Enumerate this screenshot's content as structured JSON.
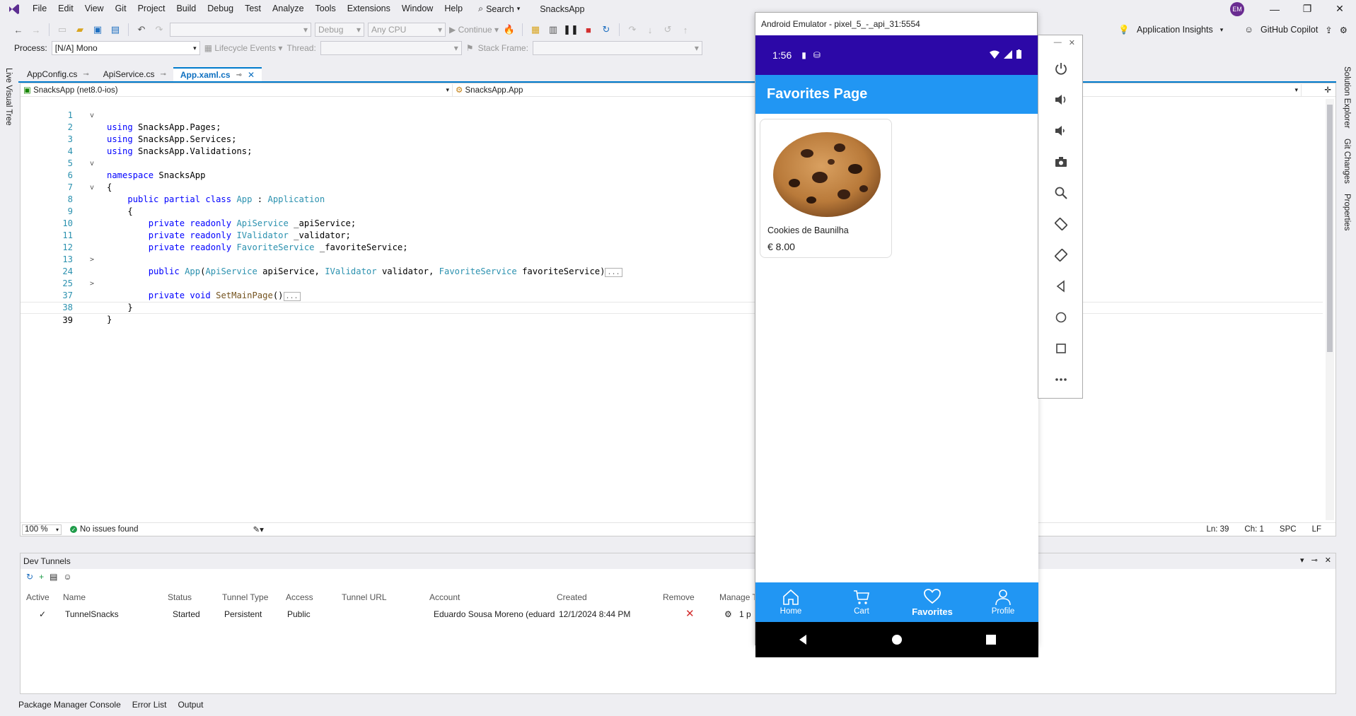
{
  "menubar": {
    "items": [
      "File",
      "Edit",
      "View",
      "Git",
      "Project",
      "Build",
      "Debug",
      "Test",
      "Analyze",
      "Tools",
      "Extensions",
      "Window",
      "Help"
    ],
    "search_label": "Search",
    "solution_name": "SnacksApp",
    "avatar_initials": "EM"
  },
  "toolbar": {
    "config": "Debug",
    "platform": "Any CPU",
    "continue_label": "Continue",
    "app_insights": "Application Insights",
    "copilot": "GitHub Copilot"
  },
  "debug_toolbar": {
    "process_label": "Process:",
    "process_value": "[N/A] Mono",
    "lifecycle": "Lifecycle Events",
    "thread_label": "Thread:",
    "stack_label": "Stack Frame:"
  },
  "side_tabs": {
    "left": "Live Visual Tree",
    "right": [
      "Solution Explorer",
      "Git Changes",
      "Properties"
    ]
  },
  "doc_tabs": [
    {
      "label": "AppConfig.cs"
    },
    {
      "label": "ApiService.cs"
    },
    {
      "label": "App.xaml.cs"
    }
  ],
  "editor": {
    "project_combo": "SnacksApp (net8.0-ios)",
    "class_combo": "SnacksApp.App",
    "zoom": "100 %",
    "issues": "No issues found",
    "ln": "Ln: 39",
    "ch": "Ch: 1",
    "spc": "SPC",
    "lf": "LF",
    "lines": [
      {
        "n": "1",
        "fold": "v"
      },
      {
        "n": "2",
        "fold": ""
      },
      {
        "n": "3",
        "fold": ""
      },
      {
        "n": "4",
        "fold": ""
      },
      {
        "n": "5",
        "fold": "v"
      },
      {
        "n": "6",
        "fold": ""
      },
      {
        "n": "7",
        "fold": "v"
      },
      {
        "n": "8",
        "fold": ""
      },
      {
        "n": "9",
        "fold": ""
      },
      {
        "n": "10",
        "fold": ""
      },
      {
        "n": "11",
        "fold": ""
      },
      {
        "n": "12",
        "fold": ""
      },
      {
        "n": "13",
        "fold": ">"
      },
      {
        "n": "24",
        "fold": ""
      },
      {
        "n": "25",
        "fold": ">"
      },
      {
        "n": "37",
        "fold": ""
      },
      {
        "n": "38",
        "fold": ""
      },
      {
        "n": "39",
        "fold": ""
      }
    ],
    "code": {
      "using1": "SnacksApp.Pages;",
      "using2": "SnacksApp.Services;",
      "using3": "SnacksApp.Validations;",
      "ns": "SnacksApp",
      "class_name": "App",
      "base": "Application",
      "f1_type": "ApiService",
      "f1_name": "_apiService;",
      "f2_type": "IValidator",
      "f2_name": "_validator;",
      "f3_type": "FavoriteService",
      "f3_name": "_favoriteService;",
      "ctor_args": "apiService, ",
      "ctor_args2": "validator, ",
      "ctor_args3": "favoriteService)",
      "method": "SetMainPage",
      "collapsed": "..."
    }
  },
  "tunnels": {
    "title": "Dev Tunnels",
    "columns": [
      "Active",
      "Name",
      "Status",
      "Tunnel Type",
      "Access",
      "Tunnel URL",
      "Account",
      "Created",
      "Remove",
      "Manage T"
    ],
    "row": {
      "active": "✓",
      "name": "TunnelSnacks",
      "status": "Started",
      "type": "Persistent",
      "access": "Public",
      "account": "Eduardo Sousa Moreno (eduard",
      "created": "12/1/2024 8:44 PM",
      "manage": "1 p"
    }
  },
  "bottom_tabs": [
    "Package Manager Console",
    "Error List",
    "Output"
  ],
  "emulator": {
    "title": "Android Emulator - pixel_5_-_api_31:5554",
    "time": "1:56",
    "page_title": "Favorites Page",
    "product_name": "Cookies de Baunilha",
    "product_price": "€ 8.00",
    "nav": [
      "Home",
      "Cart",
      "Favorites",
      "Profile"
    ],
    "colors": {
      "status": "#2c08a7",
      "appbar": "#2196f3"
    }
  }
}
